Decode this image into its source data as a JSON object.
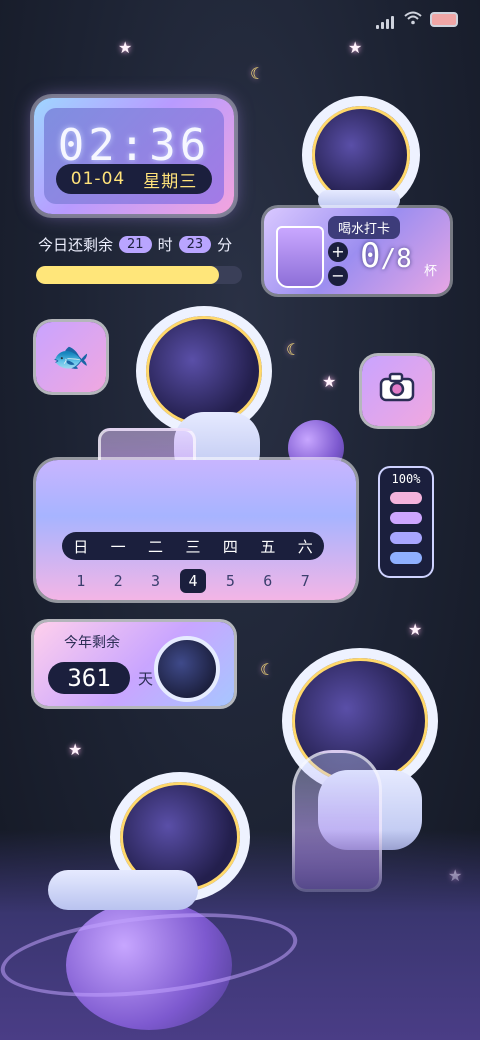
{
  "status_bar": {
    "signal_icon": "signal-icon",
    "wifi_icon": "wifi-icon",
    "battery_icon": "battery-icon"
  },
  "clock": {
    "time": "02:36",
    "date": "01-04",
    "weekday": "星期三"
  },
  "today_remaining": {
    "label": "今日还剩余",
    "hours": "21",
    "hours_unit": "时",
    "minutes": "23",
    "minutes_unit": "分",
    "progress": 0.89
  },
  "water": {
    "title": "喝水打卡",
    "plus": "+",
    "minus": "−",
    "current": "0",
    "total": "/8",
    "unit": "杯"
  },
  "apps": [
    {
      "icon": "mascot-icon"
    },
    {
      "icon": "camera-icon"
    }
  ],
  "battery_widget": {
    "label": "100%",
    "segments": [
      "#f4b3dc",
      "#cda6ff",
      "#a8a6ff",
      "#8fb0ff"
    ]
  },
  "week": {
    "days": [
      "日",
      "一",
      "二",
      "三",
      "四",
      "五",
      "六"
    ],
    "dates": [
      "1",
      "2",
      "3",
      "4",
      "5",
      "6",
      "7"
    ],
    "today_index": 3
  },
  "year_remaining": {
    "title": "今年剩余",
    "days": "361",
    "unit": "天"
  },
  "colors": {
    "accent": "#b89bff",
    "dark": "#1b1f3d",
    "yellow": "#ffe67a",
    "pink": "#f3a4de"
  }
}
